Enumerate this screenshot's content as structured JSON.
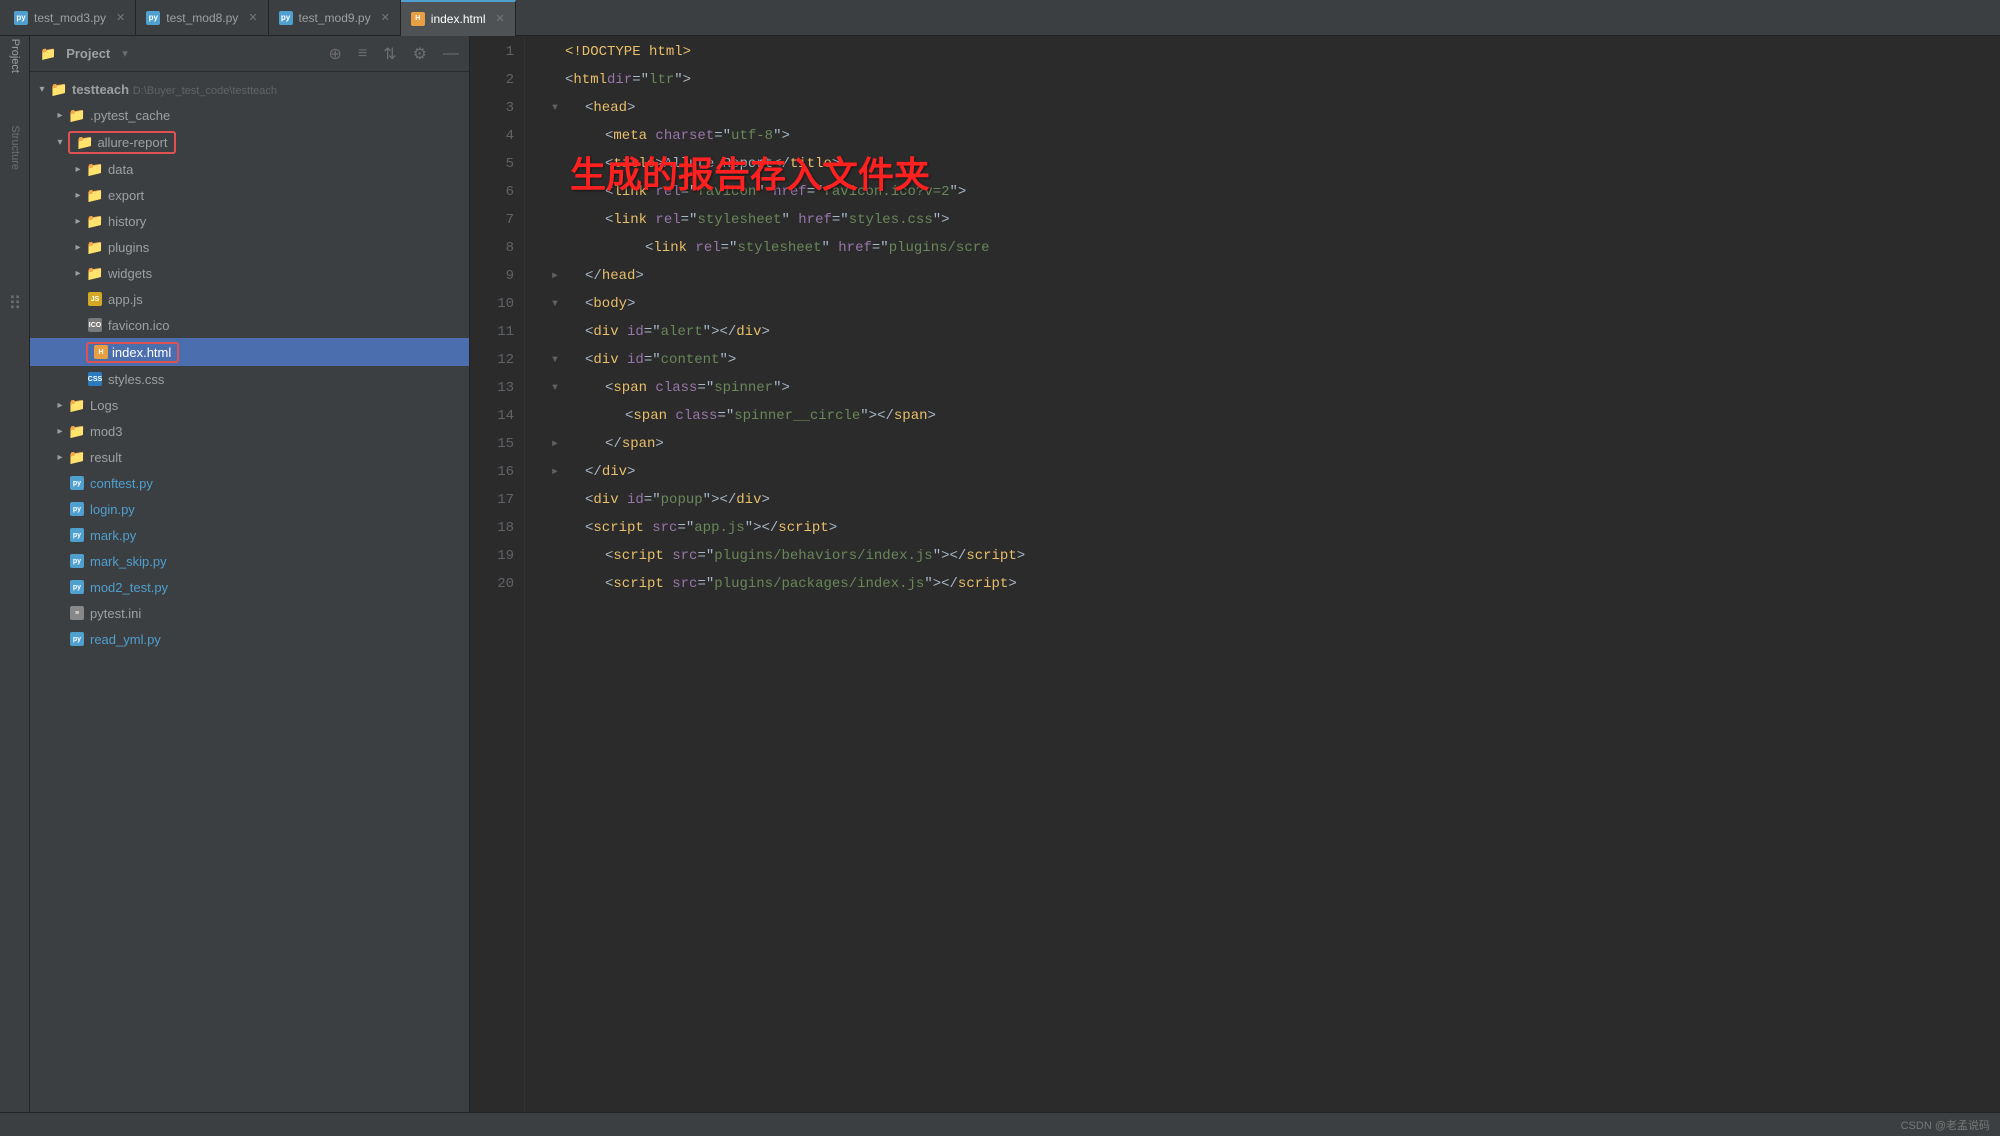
{
  "tabs": [
    {
      "id": "test_mod3",
      "label": "test_mod3.py",
      "type": "py",
      "active": false
    },
    {
      "id": "test_mod8",
      "label": "test_mod8.py",
      "type": "py",
      "active": false
    },
    {
      "id": "test_mod9",
      "label": "test_mod9.py",
      "type": "py",
      "active": false
    },
    {
      "id": "index_html",
      "label": "index.html",
      "type": "html",
      "active": true
    }
  ],
  "project_header": {
    "title": "Project",
    "path_label": "testteach",
    "path_full": "D:\\Buyer_test_code\\testteach"
  },
  "sidebar_panels": [
    "Project",
    "Structure"
  ],
  "file_tree": [
    {
      "id": "testteach",
      "level": 0,
      "label": "testteach",
      "type": "folder",
      "state": "open",
      "path": "D:\\Buyer_test_code\\testteach"
    },
    {
      "id": "pytest_cache",
      "level": 1,
      "label": ".pytest_cache",
      "type": "folder",
      "state": "closed"
    },
    {
      "id": "allure_report",
      "level": 1,
      "label": "allure-report",
      "type": "folder",
      "state": "open",
      "highlight": true
    },
    {
      "id": "data",
      "level": 2,
      "label": "data",
      "type": "folder",
      "state": "closed"
    },
    {
      "id": "export",
      "level": 2,
      "label": "export",
      "type": "folder",
      "state": "closed"
    },
    {
      "id": "history",
      "level": 2,
      "label": "history",
      "type": "folder",
      "state": "closed"
    },
    {
      "id": "plugins",
      "level": 2,
      "label": "plugins",
      "type": "folder",
      "state": "closed"
    },
    {
      "id": "widgets",
      "level": 2,
      "label": "widgets",
      "type": "folder",
      "state": "closed"
    },
    {
      "id": "app_js",
      "level": 2,
      "label": "app.js",
      "type": "js"
    },
    {
      "id": "favicon_ico",
      "level": 2,
      "label": "favicon.ico",
      "type": "ico"
    },
    {
      "id": "index_html",
      "level": 2,
      "label": "index.html",
      "type": "html",
      "selected": true,
      "highlight": true
    },
    {
      "id": "styles_css",
      "level": 2,
      "label": "styles.css",
      "type": "css"
    },
    {
      "id": "logs",
      "level": 1,
      "label": "Logs",
      "type": "folder",
      "state": "closed"
    },
    {
      "id": "mod3",
      "level": 1,
      "label": "mod3",
      "type": "folder",
      "state": "closed"
    },
    {
      "id": "result",
      "level": 1,
      "label": "result",
      "type": "folder",
      "state": "closed"
    },
    {
      "id": "conftest_py",
      "level": 1,
      "label": "conftest.py",
      "type": "py"
    },
    {
      "id": "login_py",
      "level": 1,
      "label": "login.py",
      "type": "py"
    },
    {
      "id": "mark_py",
      "level": 1,
      "label": "mark.py",
      "type": "py"
    },
    {
      "id": "mark_skip_py",
      "level": 1,
      "label": "mark_skip.py",
      "type": "py"
    },
    {
      "id": "mod2_test_py",
      "level": 1,
      "label": "mod2_test.py",
      "type": "py"
    },
    {
      "id": "pytest_ini",
      "level": 1,
      "label": "pytest.ini",
      "type": "ini"
    },
    {
      "id": "read_yml_py",
      "level": 1,
      "label": "read_yml.py",
      "type": "py"
    }
  ],
  "code_lines": [
    {
      "num": 1,
      "fold": "",
      "code": "&lt;!DOCTYPE html&gt;"
    },
    {
      "num": 2,
      "fold": "",
      "code": "&lt;html dir=\"ltr\"&gt;"
    },
    {
      "num": 3,
      "fold": "open",
      "code": "    &lt;head&gt;"
    },
    {
      "num": 4,
      "fold": "",
      "code": "        &lt;meta charset=\"utf-8\"&gt;"
    },
    {
      "num": 5,
      "fold": "",
      "code": "        &lt;title&gt;Allure Report&lt;/title&gt;"
    },
    {
      "num": 6,
      "fold": "",
      "code": "        &lt;link rel=\"favicon\" href=\"favicon.ico?v=2\"&gt;"
    },
    {
      "num": 7,
      "fold": "",
      "code": "        &lt;link rel=\"stylesheet\" href=\"styles.css\"&gt;"
    },
    {
      "num": 8,
      "fold": "",
      "code": "                &lt;link rel=\"stylesheet\" href=\"plugins/scre"
    },
    {
      "num": 9,
      "fold": "close",
      "code": "    &lt;/head&gt;"
    },
    {
      "num": 10,
      "fold": "open",
      "code": "    &lt;body&gt;"
    },
    {
      "num": 11,
      "fold": "",
      "code": "    &lt;div id=\"alert\"&gt;&lt;/div&gt;"
    },
    {
      "num": 12,
      "fold": "open",
      "code": "    &lt;div id=\"content\"&gt;"
    },
    {
      "num": 13,
      "fold": "open",
      "code": "        &lt;span class=\"spinner\"&gt;"
    },
    {
      "num": 14,
      "fold": "",
      "code": "            &lt;span class=\"spinner__circle\"&gt;&lt;/span&gt;"
    },
    {
      "num": 15,
      "fold": "close",
      "code": "        &lt;/span&gt;"
    },
    {
      "num": 16,
      "fold": "close",
      "code": "    &lt;/div&gt;"
    },
    {
      "num": 17,
      "fold": "",
      "code": "    &lt;div id=\"popup\"&gt;&lt;/div&gt;"
    },
    {
      "num": 18,
      "fold": "",
      "code": "    &lt;script src=\"app.js\"&gt;&lt;/script&gt;"
    },
    {
      "num": 19,
      "fold": "",
      "code": "        &lt;script src=\"plugins/behaviors/index.js\"&gt;&lt;/script&gt;"
    },
    {
      "num": 20,
      "fold": "",
      "code": "        &lt;script src=\"plugins/packages/index.js\"&gt;&lt;/script&gt;"
    }
  ],
  "annotation": "生成的报告存入文件夹",
  "status_bar": {
    "left": "",
    "right": "CSDN @老孟说码"
  },
  "icons": {
    "chevron_down": "▾",
    "chevron_right": "▸",
    "folder": "📁",
    "gear": "⚙",
    "minus": "—",
    "reformat": "≡",
    "sort": "⇅",
    "add": "⊕"
  }
}
